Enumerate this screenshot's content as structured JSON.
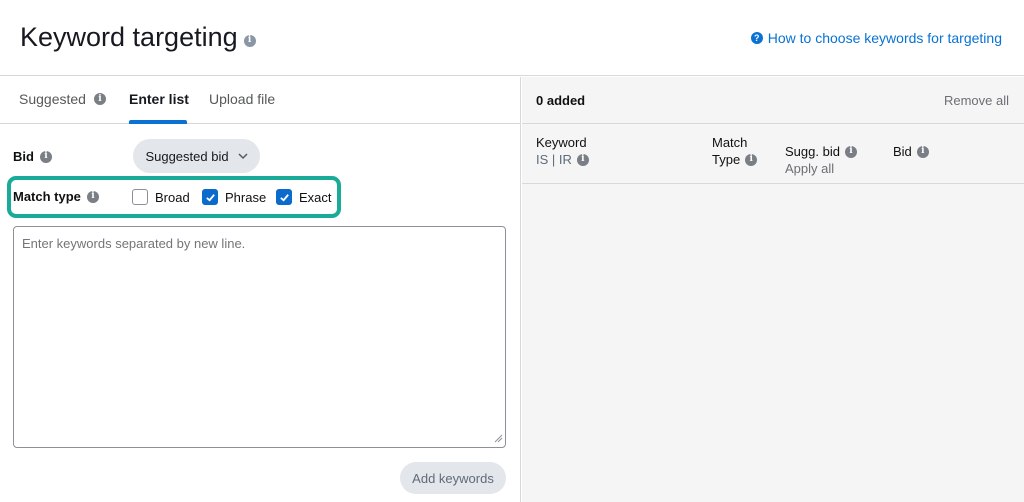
{
  "header": {
    "title": "Keyword targeting",
    "help_link": "How to choose keywords for targeting"
  },
  "tabs": [
    {
      "label": "Suggested",
      "has_info": true,
      "active": false
    },
    {
      "label": "Enter list",
      "active": true
    },
    {
      "label": "Upload file",
      "active": false
    }
  ],
  "form": {
    "bid_label": "Bid",
    "bid_value": "Suggested bid",
    "match_type_label": "Match type",
    "match_types": [
      {
        "label": "Broad",
        "checked": false
      },
      {
        "label": "Phrase",
        "checked": true
      },
      {
        "label": "Exact",
        "checked": true
      }
    ],
    "keywords_placeholder": "Enter keywords separated by new line.",
    "add_button": "Add keywords"
  },
  "added_panel": {
    "count_label": "0 added",
    "remove_all": "Remove all",
    "columns": {
      "keyword": "Keyword",
      "keyword_sub": "IS | IR",
      "match_line1": "Match",
      "match_line2": "Type",
      "sugg_bid": "Sugg. bid",
      "apply_all": "Apply all",
      "bid": "Bid"
    }
  },
  "colors": {
    "accent": "#0972d3",
    "checkbox": "#0a6bcd",
    "highlight": "#1aab98"
  }
}
